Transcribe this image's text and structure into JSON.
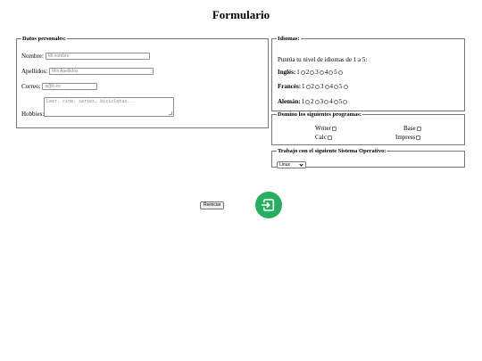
{
  "page": {
    "title": "Formulario"
  },
  "personal": {
    "legend": "Datos personales:",
    "nombre_label": "Nombre:",
    "nombre_placeholder": "Mi nombre",
    "apellidos_label": "Apellidos:",
    "apellidos_placeholder": "Mis Apellidos",
    "correo_label": "Correo:",
    "correo_placeholder": "a@b.es",
    "hobbies_label": "Hobbies:",
    "hobbies_placeholder": "Leer, cine, series, bicicletas..."
  },
  "idiomas": {
    "legend": "Idiomas:",
    "intro": "Puntúa tu nivel de idiomas de 1 a 5:",
    "levels": [
      "1",
      "2",
      "3",
      "4",
      "5"
    ],
    "languages": [
      {
        "label": "Inglés:"
      },
      {
        "label": "Francés:"
      },
      {
        "label": "Alemán:"
      }
    ]
  },
  "programas": {
    "legend": "Domino los siguientes programas:",
    "items": [
      "Writer",
      "Base",
      "Calc",
      "Impress"
    ]
  },
  "sistema": {
    "legend": "Trabajo con el siguiente Sistema Operativo:",
    "selected": "Linux"
  },
  "actions": {
    "reset_label": "Reiniciar",
    "submit_icon": "login-icon",
    "submit_color": "#27ae60"
  }
}
